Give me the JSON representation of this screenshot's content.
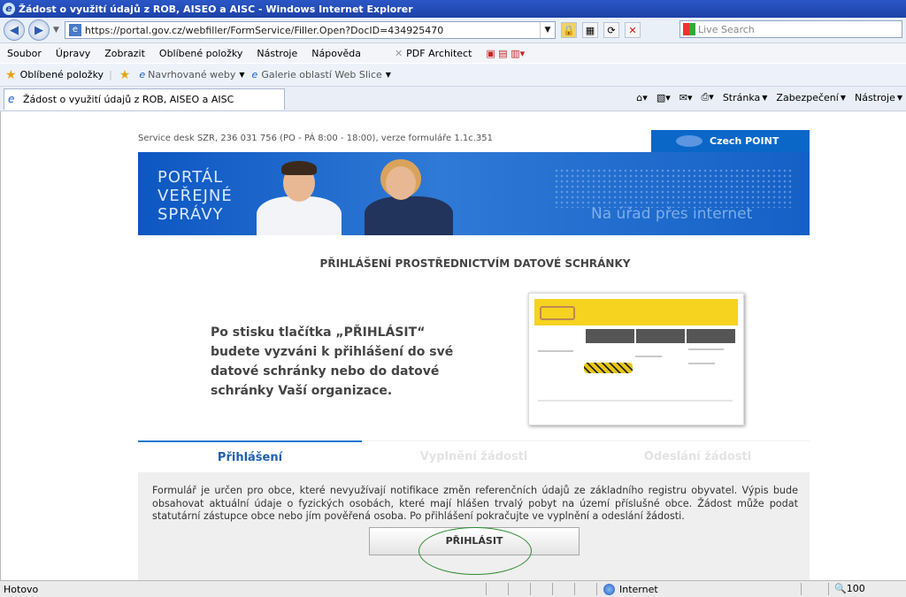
{
  "window": {
    "title": "Žádost o využití údajů z ROB, AISEO a AISC - Windows Internet Explorer"
  },
  "address": {
    "url": "https://portal.gov.cz/webfiller/FormService/Filler.Open?DocID=434925470"
  },
  "search": {
    "placeholder": "Live Search"
  },
  "menu": {
    "items": [
      "Soubor",
      "Úpravy",
      "Zobrazit",
      "Oblíbené položky",
      "Nástroje",
      "Nápověda"
    ],
    "pdf": "PDF Architect"
  },
  "favorites": {
    "label": "Oblíbené položky",
    "suggested": "Navrhované weby",
    "gallery": "Galerie oblastí Web Slice"
  },
  "tab": {
    "title": "Žádost o využití údajů z ROB, AISEO a AISC"
  },
  "commandbar": {
    "page": "Stránka",
    "security": "Zabezpečení",
    "tools": "Nástroje"
  },
  "page": {
    "service": "Service desk SZR, 236 031 756 (PO - PÁ 8:00 - 18:00), verze formuláře 1.1c.351",
    "czech_point": "Czech POINT",
    "banner_title": [
      "PORTÁL",
      "VEŘEJNÉ",
      "SPRÁVY"
    ],
    "banner_tagline": "Na úřad přes internet",
    "heading": "PŘIHLÁŠENÍ PROSTŘEDNICTVÍM DATOVÉ SCHRÁNKY",
    "instruction": "Po stisku tlačítka „PŘIHLÁSIT“ budete vyzváni k přihlášení do své datové schránky nebo do datové schránky Vaší organizace.",
    "tabs": [
      "Přihlášení",
      "Vyplnění žádosti",
      "Odeslání žádosti"
    ],
    "form_text": "Formulář je určen pro obce, které nevyužívají notifikace změn referenčních údajů ze základního registru obyvatel. Výpis bude obsahovat aktuální údaje o fyzických osobách, které mají hlášen trvalý pobyt na území příslušné obce. Žádost může podat statutární zástupce obce nebo jím pověřená osoba. Po přihlášení pokračujte ve vyplnění a odeslání žádosti.",
    "login_button": "PŘIHLÁSIT"
  },
  "status": {
    "left": "Hotovo",
    "zone": "Internet",
    "zoom": "100"
  }
}
